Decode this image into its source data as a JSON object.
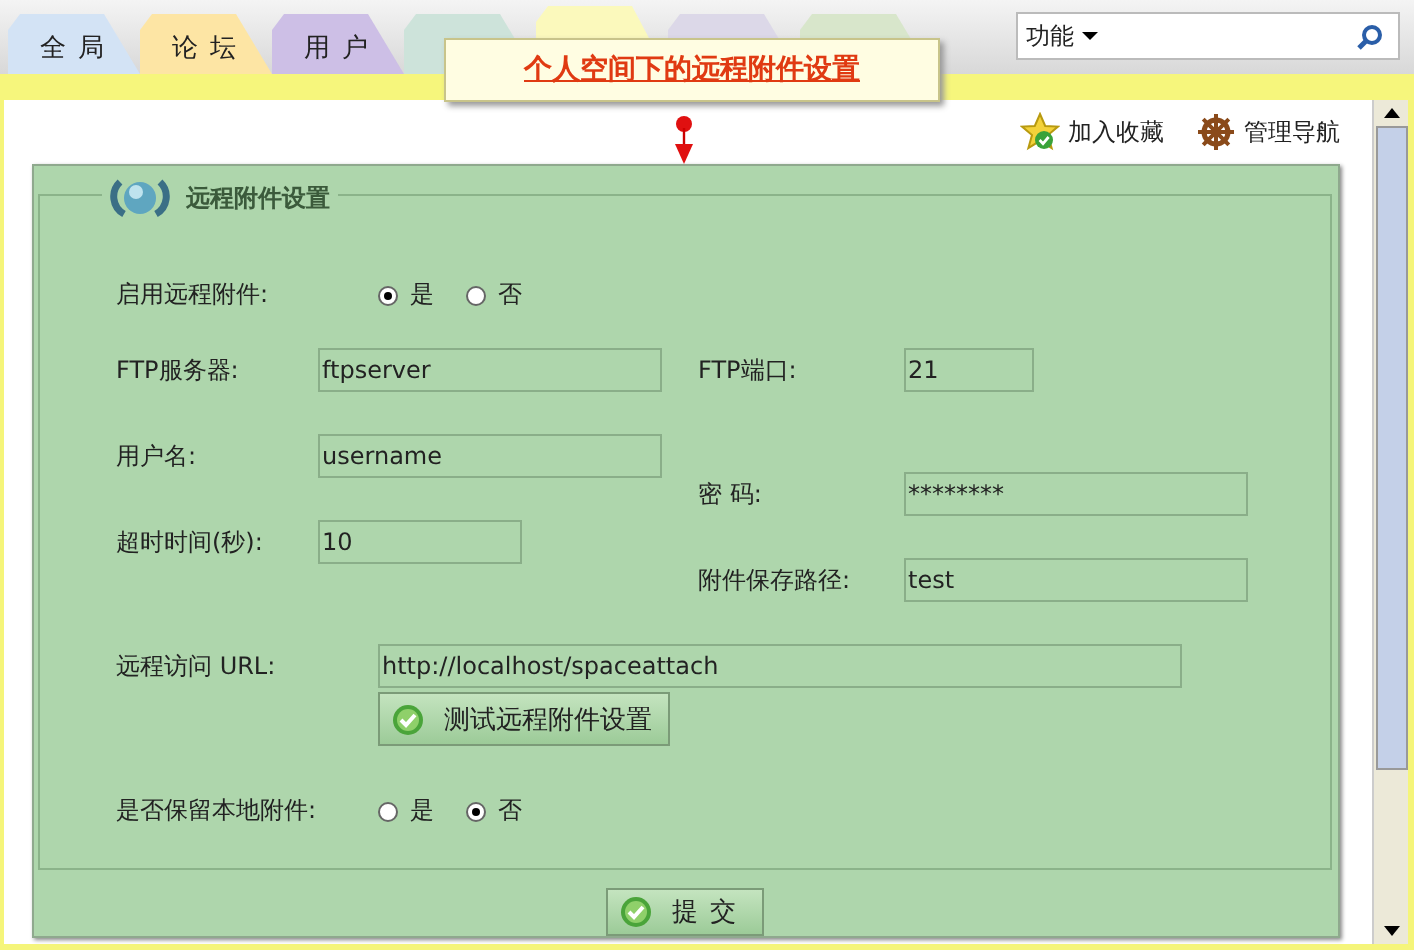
{
  "tabs": [
    {
      "label": "全 局",
      "color": "#d3e3f5",
      "selected": false
    },
    {
      "label": "论 坛",
      "color": "#fde5a4",
      "selected": false
    },
    {
      "label": "用 户",
      "color": "#cdbfe6",
      "selected": false
    },
    {
      "color": "#cde3da",
      "selected": false
    },
    {
      "color": "#fbf9bc",
      "selected": true
    },
    {
      "color": "#dcd8e8",
      "selected": false
    },
    {
      "color": "#d8e6cb",
      "selected": false
    }
  ],
  "function_menu": {
    "label": "功能"
  },
  "callout": {
    "text": "个人空间下的远程附件设置"
  },
  "toolbar_links": [
    {
      "kind": "star",
      "label": "加入收藏"
    },
    {
      "kind": "wheel",
      "label": "管理导航"
    }
  ],
  "panel": {
    "title": "远程附件设置",
    "enable_row": {
      "label": "启用远程附件:",
      "options": [
        {
          "label": "是",
          "selected": true
        },
        {
          "label": "否",
          "selected": false
        }
      ]
    },
    "left_fields": [
      {
        "label": "FTP服务器:",
        "value": "ftpserver"
      },
      {
        "label": "用户名:",
        "value": "username"
      },
      {
        "label": "超时时间(秒):",
        "value": "10"
      }
    ],
    "right_fields": [
      {
        "label": "FTP端口:",
        "value": "21"
      },
      {
        "label": "密 码:",
        "value": "********"
      },
      {
        "label": "附件保存路径:",
        "value": "test"
      }
    ],
    "url_field": {
      "label": "远程访问 URL:",
      "value": "http://localhost/spaceattach"
    },
    "test_button": "测试远程附件设置",
    "keep_row": {
      "label": "是否保留本地附件:",
      "options": [
        {
          "label": "是",
          "selected": false
        },
        {
          "label": "否",
          "selected": true
        }
      ]
    },
    "submit_button": "提 交"
  }
}
